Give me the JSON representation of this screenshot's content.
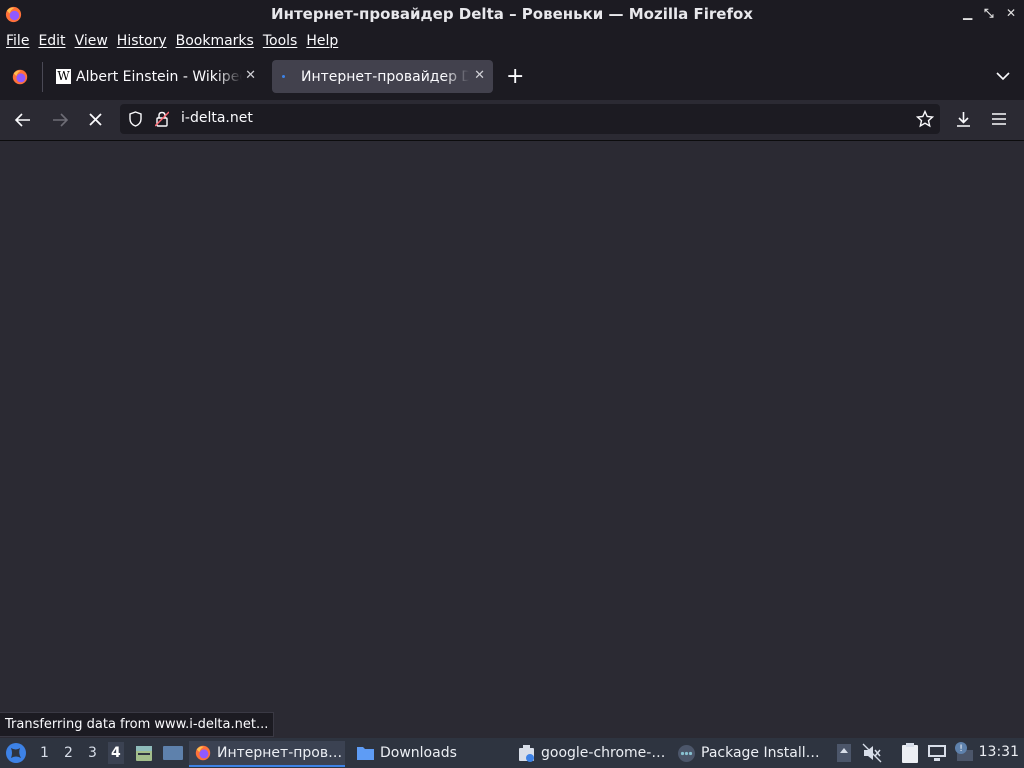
{
  "window": {
    "title": "Интернет-провайдер Delta – Ровеньки — Mozilla Firefox",
    "controls": [
      "minimize",
      "maximize",
      "close"
    ]
  },
  "menu": [
    "File",
    "Edit",
    "View",
    "History",
    "Bookmarks",
    "Tools",
    "Help"
  ],
  "tabs": [
    {
      "title": "Albert Einstein - Wikipedia",
      "icon": "wikipedia-icon",
      "active": false
    },
    {
      "title": "Интернет-провайдер Delta – Ровеньки",
      "icon": "loading-dot-icon",
      "active": true
    }
  ],
  "navbar": {
    "url": "i-delta.net",
    "buttons": [
      "back",
      "forward",
      "stop",
      "bookmark-star",
      "downloads",
      "menu"
    ]
  },
  "status": "Transferring data from www.i-delta.net...",
  "taskbar": {
    "workspaces": [
      "1",
      "2",
      "3",
      "4"
    ],
    "active_workspace": "4",
    "tasks": [
      {
        "label": "Интернет-пров…",
        "icon": "firefox-icon"
      },
      {
        "label": "Downloads",
        "icon": "folder-icon"
      },
      {
        "label": "google-chrome-…",
        "icon": "package-icon"
      },
      {
        "label": "Package Install…",
        "icon": "installer-icon"
      }
    ],
    "clock": "13:31"
  },
  "colors": {
    "chrome_bg": "#1c1b22",
    "content_bg": "#2b2a33",
    "taskbar_bg": "#2e3440",
    "accent": "#3d82e6"
  }
}
